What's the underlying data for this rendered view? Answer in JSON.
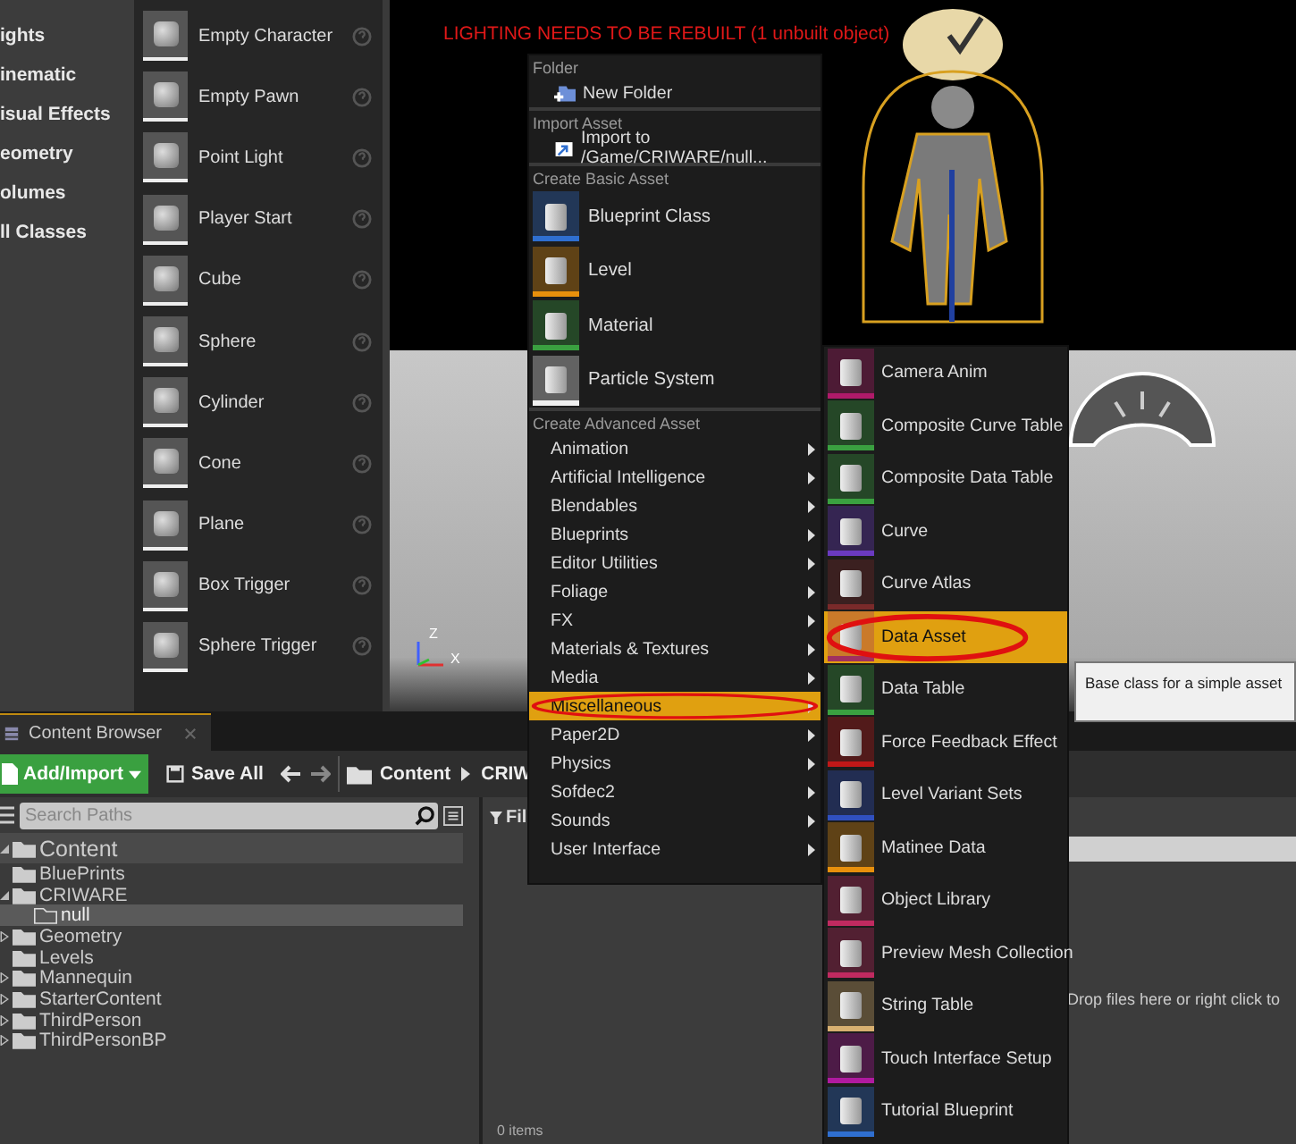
{
  "place_actors": {
    "categories": [
      "ights",
      "inematic",
      "isual Effects",
      "eometry",
      "olumes",
      "ll Classes"
    ],
    "items": [
      "Empty Character",
      "Empty Pawn",
      "Point Light",
      "Player Start",
      "Cube",
      "Sphere",
      "Cylinder",
      "Cone",
      "Plane",
      "Box Trigger",
      "Sphere Trigger"
    ]
  },
  "viewport": {
    "warning": "LIGHTING NEEDS TO BE REBUILT (1 unbuilt object)",
    "axis_labels": [
      "Z",
      "X"
    ]
  },
  "content_browser": {
    "tab": "Content Browser",
    "add_import": "Add/Import",
    "save_all": "Save All",
    "breadcrumb": [
      "Content",
      "CRIW"
    ],
    "search": {
      "placeholder": "Search Paths"
    },
    "tree": [
      {
        "label": "Content",
        "expanded": true,
        "selected": false,
        "children": [
          {
            "label": "BluePrints",
            "selected": false
          },
          {
            "label": "CRIWARE",
            "expanded": true,
            "selected": false,
            "children": [
              {
                "label": "null",
                "selected": true
              }
            ]
          },
          {
            "label": "Geometry",
            "expanded": false,
            "selected": false
          },
          {
            "label": "Levels",
            "selected": false
          },
          {
            "label": "Mannequin",
            "expanded": false,
            "selected": false
          },
          {
            "label": "StarterContent",
            "expanded": false,
            "selected": false
          },
          {
            "label": "ThirdPerson",
            "expanded": false,
            "selected": false
          },
          {
            "label": "ThirdPersonBP",
            "expanded": false,
            "selected": false
          }
        ]
      }
    ],
    "filters": "Fil",
    "drop_hint": "Drop files here or right click to",
    "item_count": "0 items"
  },
  "context_menu": {
    "sections": [
      {
        "header": "Folder",
        "kind": "small",
        "items": [
          {
            "label": "New Folder",
            "kind": "folder"
          }
        ]
      },
      {
        "header": "Import Asset",
        "kind": "small",
        "items": [
          {
            "label": "Import to /Game/CRIWARE/null...",
            "kind": "import"
          }
        ]
      },
      {
        "header": "Create Basic Asset",
        "kind": "large",
        "items": [
          {
            "label": "Blueprint Class",
            "color": "#2f6fd0"
          },
          {
            "label": "Level",
            "color": "#e8900c"
          },
          {
            "label": "Material",
            "color": "#3aa040"
          },
          {
            "label": "Particle System",
            "color": "#f0f0f0"
          }
        ]
      },
      {
        "header": "Create Advanced Asset",
        "kind": "submenu",
        "items": [
          {
            "label": "Animation",
            "selected": false
          },
          {
            "label": "Artificial Intelligence",
            "selected": false
          },
          {
            "label": "Blendables",
            "selected": false
          },
          {
            "label": "Blueprints",
            "selected": false
          },
          {
            "label": "Editor Utilities",
            "selected": false
          },
          {
            "label": "Foliage",
            "selected": false
          },
          {
            "label": "FX",
            "selected": false
          },
          {
            "label": "Materials & Textures",
            "selected": false
          },
          {
            "label": "Media",
            "selected": false
          },
          {
            "label": "Miscellaneous",
            "selected": true
          },
          {
            "label": "Paper2D",
            "selected": false
          },
          {
            "label": "Physics",
            "selected": false
          },
          {
            "label": "Sofdec2",
            "selected": false
          },
          {
            "label": "Sounds",
            "selected": false
          },
          {
            "label": "User Interface",
            "selected": false
          }
        ]
      }
    ]
  },
  "submenu": {
    "items": [
      {
        "label": "Camera Anim",
        "color": "#b01a6a",
        "selected": false
      },
      {
        "label": "Composite Curve Table",
        "color": "#3aa040",
        "selected": false
      },
      {
        "label": "Composite Data Table",
        "color": "#3aa040",
        "selected": false
      },
      {
        "label": "Curve",
        "color": "#6a3ac0",
        "selected": false
      },
      {
        "label": "Curve Atlas",
        "color": "#7a2a2a",
        "selected": false
      },
      {
        "label": "Data Asset",
        "color": "#a03060",
        "selected": true
      },
      {
        "label": "Data Table",
        "color": "#3aa040",
        "selected": false
      },
      {
        "label": "Force Feedback Effect",
        "color": "#c01818",
        "selected": false
      },
      {
        "label": "Level Variant Sets",
        "color": "#3050c0",
        "selected": false
      },
      {
        "label": "Matinee Data",
        "color": "#e8900c",
        "selected": false
      },
      {
        "label": "Object Library",
        "color": "#c02a60",
        "selected": false
      },
      {
        "label": "Preview Mesh Collection",
        "color": "#c02a60",
        "selected": false
      },
      {
        "label": "String Table",
        "color": "#d8b070",
        "selected": false
      },
      {
        "label": "Touch Interface Setup",
        "color": "#b01aa0",
        "selected": false
      },
      {
        "label": "Tutorial Blueprint",
        "color": "#2f6fd0",
        "selected": false
      }
    ]
  },
  "tooltip": {
    "text": "Base class for a simple asset"
  }
}
